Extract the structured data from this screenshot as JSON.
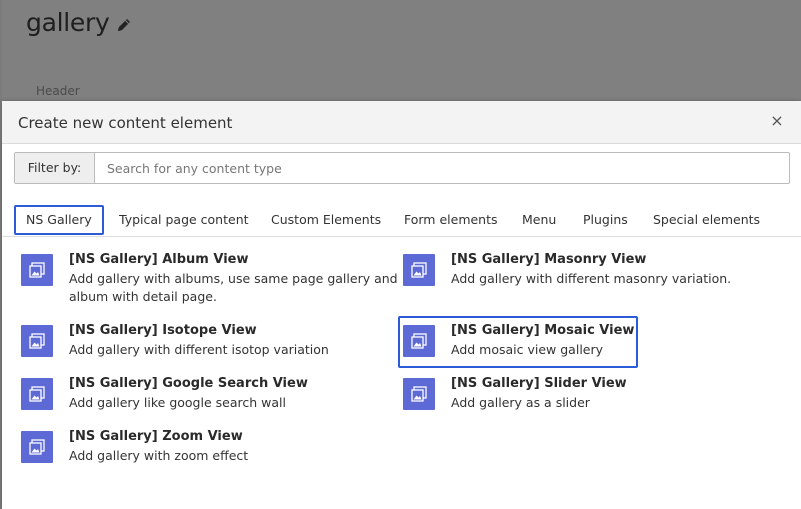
{
  "background": {
    "page_title": "gallery",
    "header_label": "Header"
  },
  "modal": {
    "title": "Create new content element",
    "close_label": "×",
    "filter": {
      "label": "Filter by:",
      "placeholder": "Search for any content type"
    },
    "tabs": [
      {
        "label": "NS Gallery",
        "active": true
      },
      {
        "label": "Typical page content"
      },
      {
        "label": "Custom Elements"
      },
      {
        "label": "Form elements"
      },
      {
        "label": "Menu"
      },
      {
        "label": "Plugins"
      },
      {
        "label": "Special elements"
      }
    ],
    "items": [
      {
        "title": "[NS Gallery] Album View",
        "desc": "Add gallery with albums, use same page gallery and album with detail page.",
        "icon": "image-icon"
      },
      {
        "title": "[NS Gallery] Masonry View",
        "desc": "Add gallery with different masonry variation.",
        "icon": "image-icon"
      },
      {
        "title": "[NS Gallery] Isotope View",
        "desc": "Add gallery with different isotop variation",
        "icon": "image-icon"
      },
      {
        "title": "[NS Gallery] Mosaic View",
        "desc": "Add mosaic view gallery",
        "icon": "image-icon",
        "highlighted": true
      },
      {
        "title": "[NS Gallery] Google Search View",
        "desc": "Add gallery like google search wall",
        "icon": "image-icon"
      },
      {
        "title": "[NS Gallery] Slider View",
        "desc": "Add gallery as a slider",
        "icon": "image-icon"
      },
      {
        "title": "[NS Gallery] Zoom View",
        "desc": "Add gallery with zoom effect",
        "icon": "image-icon"
      }
    ]
  },
  "colors": {
    "accent": "#2b5bd6",
    "icon_bg": "#5d6ad6",
    "overlay": "#808080"
  }
}
